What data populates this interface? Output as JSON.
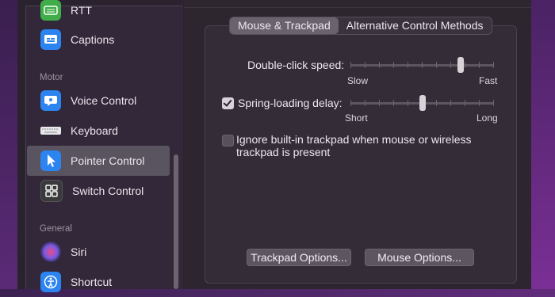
{
  "sidebar": {
    "items": [
      {
        "label": "RTT",
        "icon": "rtt-icon",
        "color": "#3fae4a"
      },
      {
        "label": "Captions",
        "icon": "captions-icon",
        "color": "#2c84f0"
      },
      {
        "label": "Voice Control",
        "icon": "voice-control-icon",
        "color": "#2c84f0"
      },
      {
        "label": "Keyboard",
        "icon": "keyboard-icon",
        "color": "#e8e8ea"
      },
      {
        "label": "Pointer Control",
        "icon": "pointer-icon",
        "color": "#2c84f0"
      },
      {
        "label": "Switch Control",
        "icon": "switch-control-icon",
        "color": "#3a3a3c"
      },
      {
        "label": "Siri",
        "icon": "siri-icon",
        "color": "#7b5be0"
      },
      {
        "label": "Shortcut",
        "icon": "shortcut-icon",
        "color": "#2c84f0"
      }
    ],
    "sections": {
      "motor": "Motor",
      "general": "General"
    },
    "selected": "Pointer Control"
  },
  "tabs": {
    "active": "Mouse & Trackpad",
    "other": "Alternative Control Methods"
  },
  "double_click": {
    "label": "Double-click speed:",
    "min_label": "Slow",
    "max_label": "Fast",
    "value_fraction": 0.78
  },
  "spring_loading": {
    "label": "Spring-loading delay:",
    "checked": true,
    "min_label": "Short",
    "max_label": "Long",
    "value_fraction": 0.5
  },
  "ignore_trackpad": {
    "line1": "Ignore built-in trackpad when mouse or wireless",
    "line2": "trackpad is present",
    "checked": false
  },
  "buttons": {
    "trackpad_options": "Trackpad Options...",
    "mouse_options": "Mouse Options..."
  }
}
